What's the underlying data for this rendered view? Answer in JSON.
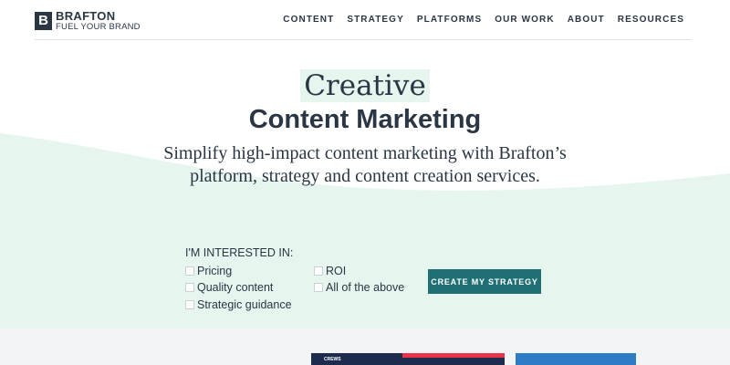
{
  "brand": {
    "mark": "B",
    "name": "BRAFTON",
    "tagline": "FUEL YOUR BRAND"
  },
  "nav": {
    "items": [
      "CONTENT",
      "STRATEGY",
      "PLATFORMS",
      "OUR WORK",
      "ABOUT",
      "RESOURCES"
    ]
  },
  "hero": {
    "script": "Creative",
    "bold": "Content Marketing",
    "subhead_line1": "Simplify high-impact content marketing with Brafton’s",
    "subhead_line2": "platform, strategy and content creation services."
  },
  "form": {
    "label": "I'M INTERESTED IN:",
    "options": [
      "Pricing",
      "Quality content",
      "Strategic guidance",
      "ROI",
      "All of the above"
    ],
    "cta": "CREATE MY STRATEGY"
  },
  "cards": {
    "card1_text": "CREWS"
  },
  "colors": {
    "brand_dark": "#2a3644",
    "accent_teal": "#1f6f74",
    "wave_mint": "#e6f5ee"
  }
}
